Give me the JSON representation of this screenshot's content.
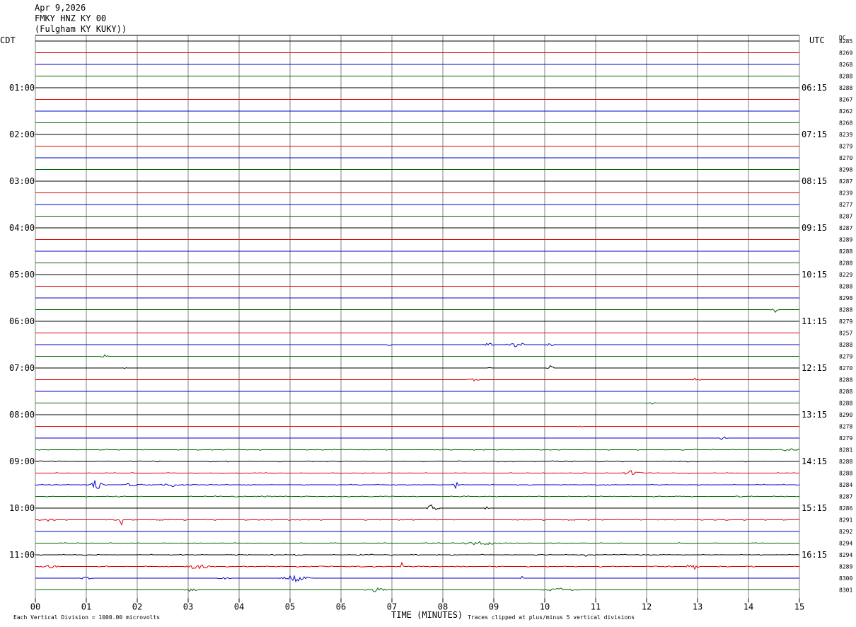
{
  "header": {
    "date": "Apr 9,2026",
    "station": "FMKY HNZ KY 00",
    "location": "(Fulgham KY KUKY))"
  },
  "labels": {
    "left_tz": "CDT",
    "right_tz": "UTC",
    "dc": "DC",
    "xlabel": "TIME (MINUTES)",
    "scale_note": "Each Vertical Division = 1000.00 microvolts",
    "clip_note": "Traces clipped at plus/minus 5 vertical divisions"
  },
  "colors": {
    "grid": "#808080",
    "traces": [
      "#000000",
      "#dd0000",
      "#0000cc",
      "#006600"
    ]
  },
  "chart_data": {
    "type": "line",
    "x_ticks": [
      "00",
      "01",
      "02",
      "03",
      "04",
      "05",
      "06",
      "07",
      "08",
      "09",
      "10",
      "11",
      "12",
      "13",
      "14",
      "15"
    ],
    "xlim": [
      0,
      15
    ],
    "row_count": 48,
    "left_hour_labels": [
      {
        "row": 4,
        "text": "01:00"
      },
      {
        "row": 8,
        "text": "02:00"
      },
      {
        "row": 12,
        "text": "03:00"
      },
      {
        "row": 16,
        "text": "04:00"
      },
      {
        "row": 20,
        "text": "05:00"
      },
      {
        "row": 24,
        "text": "06:00"
      },
      {
        "row": 28,
        "text": "07:00"
      },
      {
        "row": 32,
        "text": "08:00"
      },
      {
        "row": 36,
        "text": "09:00"
      },
      {
        "row": 40,
        "text": "10:00"
      },
      {
        "row": 44,
        "text": "11:00"
      }
    ],
    "right_hour_labels": [
      {
        "row": 4,
        "text": "06:15"
      },
      {
        "row": 8,
        "text": "07:15"
      },
      {
        "row": 12,
        "text": "08:15"
      },
      {
        "row": 16,
        "text": "09:15"
      },
      {
        "row": 20,
        "text": "10:15"
      },
      {
        "row": 24,
        "text": "11:15"
      },
      {
        "row": 28,
        "text": "12:15"
      },
      {
        "row": 32,
        "text": "13:15"
      },
      {
        "row": 36,
        "text": "14:15"
      },
      {
        "row": 40,
        "text": "15:15"
      },
      {
        "row": 44,
        "text": "16:15"
      }
    ],
    "dc_values": [
      "8285",
      "8269",
      "8268",
      "8288",
      "8288",
      "8267",
      "8262",
      "8268",
      "8239",
      "8279",
      "8270",
      "8298",
      "8287",
      "8239",
      "8277",
      "8287",
      "8287",
      "8289",
      "8288",
      "8288",
      "8229",
      "8288",
      "8298",
      "8288",
      "8279",
      "8257",
      "8288",
      "8279",
      "8270",
      "8288",
      "8288",
      "8288",
      "8290",
      "8278",
      "8279",
      "8281",
      "8288",
      "8288",
      "8284",
      "8287",
      "8286",
      "8291",
      "8292",
      "8294",
      "8294",
      "8289",
      "8300",
      "8301"
    ],
    "events": [
      {
        "row": 23,
        "x": 14.52,
        "amp": 4,
        "w": 0.1
      },
      {
        "row": 26,
        "x": 6.95,
        "amp": 3,
        "w": 0.05
      },
      {
        "row": 26,
        "x": 8.9,
        "amp": 4,
        "w": 0.12
      },
      {
        "row": 26,
        "x": 9.4,
        "amp": 4,
        "w": 0.2
      },
      {
        "row": 26,
        "x": 9.58,
        "amp": 5,
        "w": 0.04
      },
      {
        "row": 26,
        "x": 10.1,
        "amp": 3,
        "w": 0.12
      },
      {
        "row": 27,
        "x": 1.35,
        "amp": 3,
        "w": 0.1
      },
      {
        "row": 28,
        "x": 1.75,
        "amp": 2,
        "w": 0.05
      },
      {
        "row": 28,
        "x": 8.92,
        "amp": 3,
        "w": 0.05
      },
      {
        "row": 28,
        "x": 10.12,
        "amp": 4,
        "w": 0.08
      },
      {
        "row": 29,
        "x": 8.6,
        "amp": 3,
        "w": 0.15
      },
      {
        "row": 29,
        "x": 13.0,
        "amp": 5,
        "w": 0.1
      },
      {
        "row": 31,
        "x": 12.1,
        "amp": 2,
        "w": 0.1
      },
      {
        "row": 33,
        "x": 10.7,
        "amp": 2,
        "w": 0.06
      },
      {
        "row": 34,
        "x": 13.5,
        "amp": 3,
        "w": 0.1
      },
      {
        "row": 35,
        "x": 14.8,
        "amp": 2,
        "w": 0.25
      },
      {
        "row": 37,
        "x": 11.7,
        "amp": 4,
        "w": 0.25
      },
      {
        "row": 38,
        "x": 1.2,
        "amp": 8,
        "w": 0.15
      },
      {
        "row": 38,
        "x": 1.9,
        "amp": 3,
        "w": 0.2
      },
      {
        "row": 38,
        "x": 2.7,
        "amp": 3,
        "w": 0.3
      },
      {
        "row": 38,
        "x": 8.25,
        "amp": 5,
        "w": 0.08
      },
      {
        "row": 40,
        "x": 7.8,
        "amp": 6,
        "w": 0.15
      },
      {
        "row": 40,
        "x": 8.85,
        "amp": 3,
        "w": 0.05
      },
      {
        "row": 41,
        "x": 1.7,
        "amp": 9,
        "w": 0.05
      },
      {
        "row": 41,
        "x": 0.25,
        "amp": 2,
        "w": 0.2
      },
      {
        "row": 43,
        "x": 8.8,
        "amp": 3,
        "w": 0.5
      },
      {
        "row": 44,
        "x": 10.8,
        "amp": 16,
        "w": 0.02
      },
      {
        "row": 44,
        "x": 11.2,
        "amp": 4,
        "w": 0.02
      },
      {
        "row": 45,
        "x": 3.2,
        "amp": 5,
        "w": 0.3
      },
      {
        "row": 45,
        "x": 7.2,
        "amp": 7,
        "w": 0.03
      },
      {
        "row": 45,
        "x": 12.9,
        "amp": 7,
        "w": 0.15
      },
      {
        "row": 45,
        "x": 0.3,
        "amp": 3,
        "w": 0.2
      },
      {
        "row": 46,
        "x": 1.0,
        "amp": 3,
        "w": 0.15
      },
      {
        "row": 46,
        "x": 3.7,
        "amp": 3,
        "w": 0.15
      },
      {
        "row": 46,
        "x": 5.1,
        "amp": 5,
        "w": 0.35
      },
      {
        "row": 46,
        "x": 9.55,
        "amp": 3,
        "w": 0.05
      },
      {
        "row": 47,
        "x": 3.05,
        "amp": 3,
        "w": 0.15
      },
      {
        "row": 47,
        "x": 6.7,
        "amp": 3,
        "w": 0.3
      },
      {
        "row": 47,
        "x": 10.3,
        "amp": 3,
        "w": 0.4
      }
    ],
    "noisy_rows": [
      35,
      36,
      37,
      38,
      39,
      41,
      43,
      44,
      45
    ]
  }
}
